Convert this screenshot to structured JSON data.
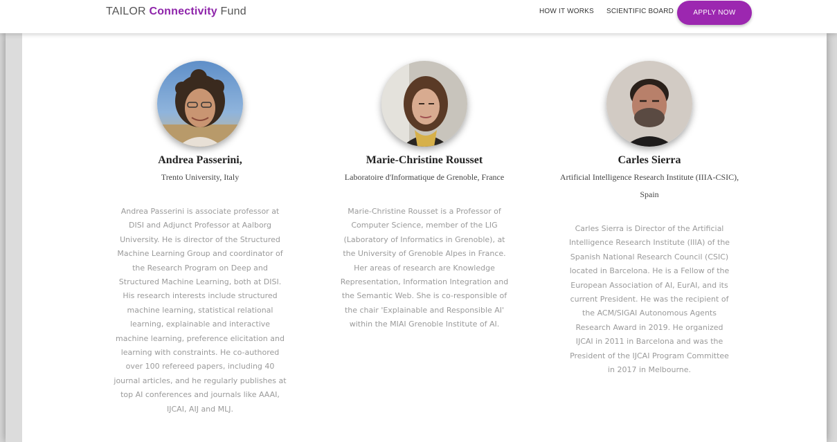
{
  "header": {
    "brand_prefix": "TAILOR ",
    "brand_strong": "Connectivity",
    "brand_suffix": " Fund",
    "nav": [
      "HOW IT WORKS",
      "SCIENTIFIC BOARD"
    ],
    "apply_label": "APPLY NOW",
    "accent_color": "#9c27b0"
  },
  "people": [
    {
      "name": "Andrea Passerini,",
      "affiliation": "Trento University, Italy",
      "bio": "Andrea Passerini is associate professor at DISI and Adjunct Professor at Aalborg University. He is director of the Structured Machine Learning Group and coordinator of the Research Program on Deep and Structured Machine Learning, both at DISI. His research interests include structured machine learning, statistical relational learning, explainable and interactive machine learning, preference elicitation and learning with constraints. He co-authored over 100 refereed papers, including 40 journal articles, and he regularly publishes at top AI conferences and journals like AAAI, IJCAI, AIJ and MLJ."
    },
    {
      "name": "Marie-Christine Rousset",
      "affiliation": "Laboratoire d'Informatique de Grenoble, France",
      "bio": "Marie-Christine Rousset is a Professor of Computer Science, member of the LIG (Laboratory of Informatics in Grenoble), at the University of Grenoble Alpes in France. Her areas of research are Knowledge Representation, Information Integration and the Semantic Web. She is co-responsible of the chair 'Explainable and Responsible AI' within the MIAI Grenoble Institute of AI."
    },
    {
      "name": "Carles Sierra",
      "affiliation": "Artificial Intelligence Research Institute (IIIA-CSIC), Spain",
      "bio": "Carles Sierra is Director of the Artificial Intelligence Research Institute (IIIA) of the Spanish National Research Council (CSIC) located in Barcelona. He is a Fellow of the European Association of AI, EurAI, and its current President. He was the recipient of the ACM/SIGAI Autonomous Agents Research Award in 2019. He organized IJCAI in 2011 in Barcelona and was the President of the IJCAI Program Committee in 2017 in Melbourne."
    }
  ]
}
